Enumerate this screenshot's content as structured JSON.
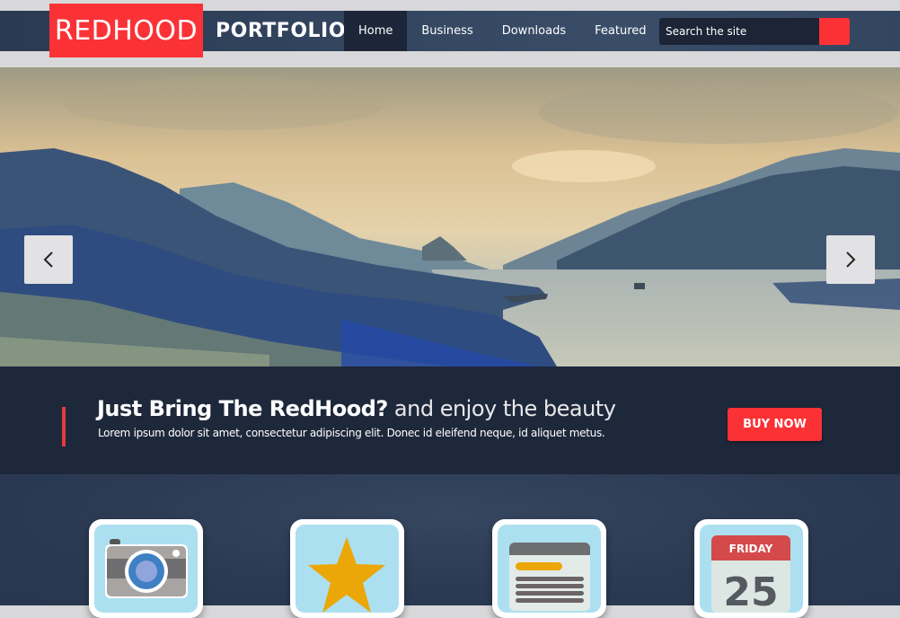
{
  "header": {
    "logo_red": "REDHOOD",
    "logo_text": "PORTFOLIO",
    "nav": [
      {
        "label": "Home",
        "active": true
      },
      {
        "label": "Business",
        "active": false
      },
      {
        "label": "Downloads",
        "active": false
      },
      {
        "label": "Featured",
        "active": false
      }
    ],
    "search": {
      "placeholder": "Search the site",
      "value": ""
    }
  },
  "slider": {
    "prev_icon": "chevron-left-icon",
    "next_icon": "chevron-right-icon"
  },
  "cta": {
    "title_bold": "Just Bring The RedHood?",
    "title_light": " and enjoy the beauty",
    "subtitle": "Lorem ipsum dolor sit amet, consectetur adipiscing elit. Donec id eleifend neque, id aliquet metus.",
    "button": "BUY NOW"
  },
  "features": [
    {
      "icon": "camera-icon"
    },
    {
      "icon": "star-icon"
    },
    {
      "icon": "document-icon"
    },
    {
      "icon": "calendar-icon",
      "day": "FRIDAY",
      "date": "25"
    }
  ],
  "colors": {
    "accent": "#fa3236",
    "nav_bg": "#33455f",
    "cta_bg": "#1e283b",
    "features_bg": "#2b3a52"
  }
}
